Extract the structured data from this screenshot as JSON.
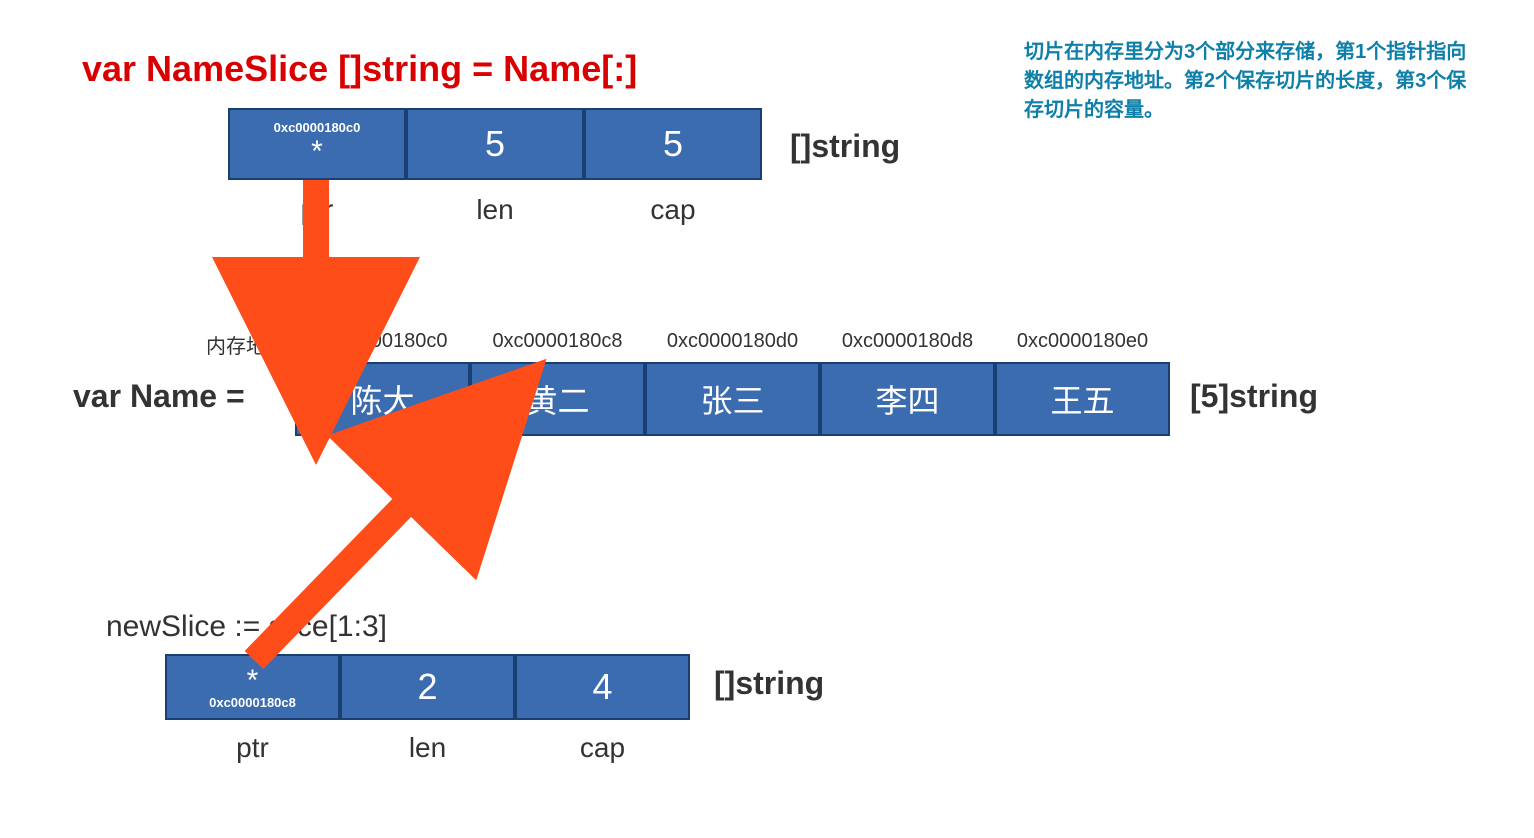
{
  "title": "var NameSlice []string = Name[:]",
  "note": "切片在内存里分为3个部分来存储，第1个指针指向数组的内存地址。第2个保存切片的长度，第3个保存切片的容量。",
  "slice1": {
    "ptr_addr": "0xc0000180c0",
    "ptr_symbol": "*",
    "len": "5",
    "cap": "5",
    "labels": {
      "ptr": "ptr",
      "len": "len",
      "cap": "cap"
    },
    "type": "[]string"
  },
  "array": {
    "decl": "var Name =",
    "mem_label": "内存地址:",
    "addrs": [
      "0xc0000180c0",
      "0xc0000180c8",
      "0xc0000180d0",
      "0xc0000180d8",
      "0xc0000180e0"
    ],
    "items": [
      "陈大",
      "黄二",
      "张三",
      "李四",
      "王五"
    ],
    "type": "[5]string"
  },
  "subslice": {
    "decl": "newSlice := slice[1:3]",
    "ptr_symbol": "*",
    "ptr_addr": "0xc0000180c8",
    "len": "2",
    "cap": "4",
    "labels": {
      "ptr": "ptr",
      "len": "len",
      "cap": "cap"
    },
    "type": "[]string"
  }
}
